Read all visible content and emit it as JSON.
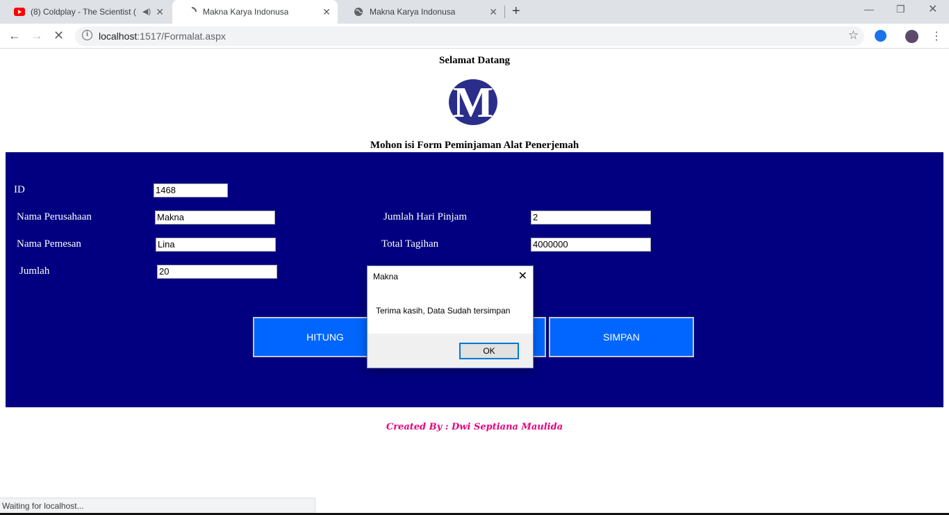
{
  "browser": {
    "tabs": [
      {
        "title": "(8) Coldplay - The Scientist (",
        "icon": "youtube-icon"
      },
      {
        "title": "Makna Karya Indonusa",
        "icon": "loading-spinner-icon"
      },
      {
        "title": "Makna Karya Indonusa",
        "icon": "globe-icon"
      }
    ],
    "url_host": "localhost",
    "url_path": ":1517/Formalat.aspx",
    "status_text": "Waiting for localhost..."
  },
  "page": {
    "welcome": "Selamat Datang",
    "logo_letter": "M",
    "form_title": "Mohon isi Form Peminjaman Alat Penerjemah",
    "fields": {
      "id_label": "ID",
      "id_value": "1468",
      "company_label": "Nama Perusahaan",
      "company_value": "Makna",
      "orderer_label": "Nama Pemesan",
      "orderer_value": "Lina",
      "qty_label": "Jumlah",
      "qty_value": "20",
      "days_label": "Jumlah Hari Pinjam",
      "days_value": "2",
      "total_label": "Total Tagihan",
      "total_value": "4000000"
    },
    "buttons": {
      "hitung": "HITUNG",
      "simpan": "SIMPAN"
    },
    "footer": "Created By : Dwi Septiana Maulida"
  },
  "dialog": {
    "title": "Makna",
    "message": "Terima kasih, Data Sudah tersimpan",
    "ok": "OK"
  },
  "colors": {
    "panel": "#020080",
    "button": "#0066ff",
    "footer": "#e6007e",
    "logo": "#2b2d8b"
  }
}
